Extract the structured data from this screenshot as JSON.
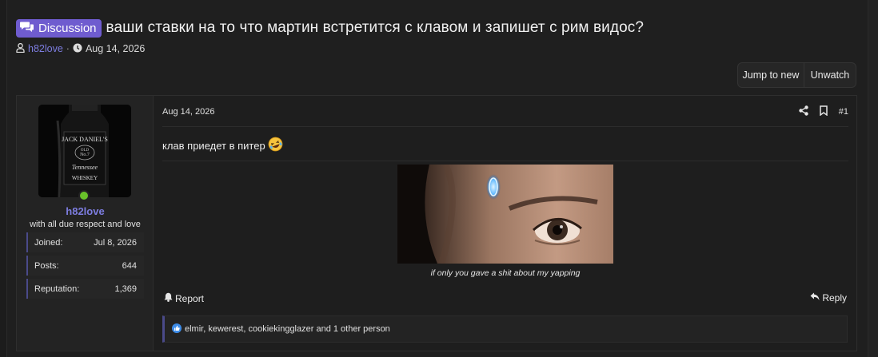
{
  "thread": {
    "prefix": "Discussion",
    "title": "ваши ставки на то что мартин встретится с клавом и запишет с рим видос?",
    "author": "h82love",
    "separator": "·",
    "date": "Aug 14, 2026"
  },
  "buttons": {
    "jump": "Jump to new",
    "unwatch": "Unwatch"
  },
  "user": {
    "name": "h82love",
    "title": "with all due respect and love",
    "stats": [
      {
        "label": "Joined:",
        "value": "Jul 8, 2026"
      },
      {
        "label": "Posts:",
        "value": "644"
      },
      {
        "label": "Reputation:",
        "value": "1,369"
      }
    ],
    "status": "online"
  },
  "post": {
    "date": "Aug 14, 2026",
    "number": "#1",
    "text": "клав приедет в питер",
    "emoji": "🤣",
    "caption": "if only you gave a shit about my yapping",
    "report": "Report",
    "reply": "Reply",
    "reactions": "elmir, kewerest, cookiekingglazer and 1 other person"
  },
  "colors": {
    "accent": "#7d7de0",
    "badge": "#6f5ccf",
    "online": "#69c22a"
  },
  "icons": [
    "discussion-icon",
    "user-icon",
    "clock-icon",
    "share-icon",
    "bookmark-icon",
    "bell-icon",
    "reply-icon",
    "like-icon"
  ]
}
